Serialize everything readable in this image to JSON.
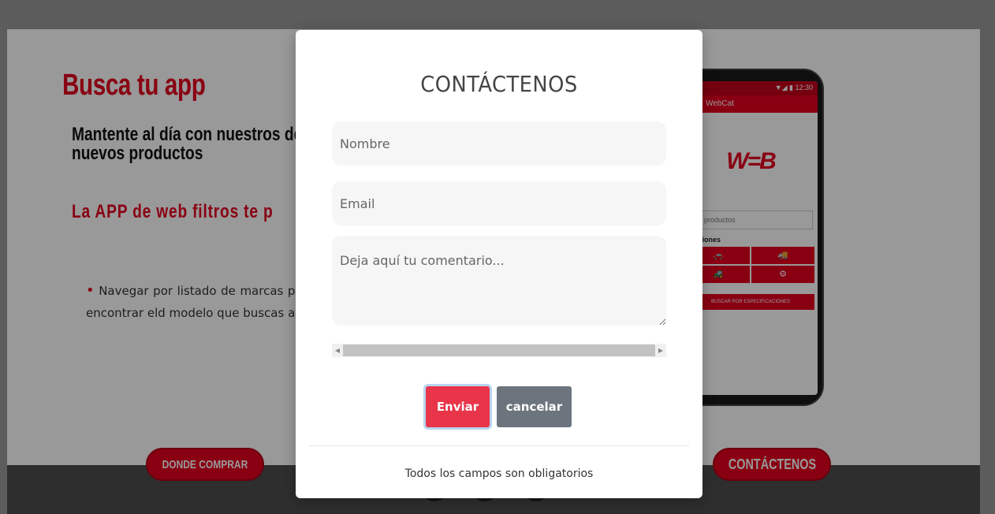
{
  "background_page": {
    "title": "Busca tu app",
    "subtitle": "Mantente al día con nuestros de nuevos productos",
    "tagline": "La APP de web filtros te p",
    "feature_bullet": "•",
    "feature_text": "Navegar por listado de marcas para encontrar eld modelo que buscas a",
    "phone": {
      "status": "▼◢ ▮ 12:30",
      "app_title": "WebCat",
      "logo": "W=B",
      "search_placeholder": "car productos",
      "section_label": "icaciones",
      "button_label": "BUSCAR POR ESPECIFICACIONES"
    },
    "footer": {
      "where_to_buy": "DONDE COMPRAR",
      "contact": "CONTÁCTENOS"
    }
  },
  "modal": {
    "title": "CONTÁCTENOS",
    "name_placeholder": "Nombre",
    "email_placeholder": "Email",
    "comment_placeholder": "Deja aquí tu comentario...",
    "send_label": "Enviar",
    "cancel_label": "cancelar",
    "note": "Todos los campos son obligatorios"
  },
  "colors": {
    "brand_red": "#e5001e",
    "send_button": "#e8354a",
    "cancel_button": "#6c757d"
  }
}
